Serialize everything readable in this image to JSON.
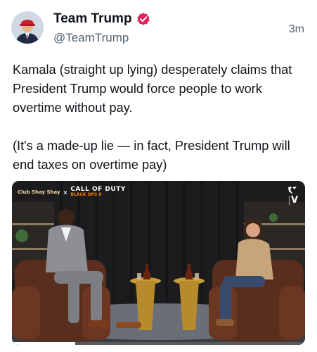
{
  "post": {
    "author_name": "Team Trump",
    "author_handle": "@TeamTrump",
    "timestamp": "3m",
    "text": "Kamala (straight up lying) desperately claims that President Trump would force people to work overtime without pay.\n\n(It's a made-up lie — in fact, President Trump will end taxes on overtime pay)"
  },
  "media": {
    "brand_sub": "Club Shay Shay",
    "brand_x": "×",
    "brand_title": "CALL OF DUTY",
    "brand_subtitle": "BLACK OPS 6",
    "network_logo": "fan-duel-tv-logo",
    "network_text": "V"
  },
  "colors": {
    "verified_badge": "#e0245e",
    "text": "#0f1419",
    "muted": "#536471"
  }
}
